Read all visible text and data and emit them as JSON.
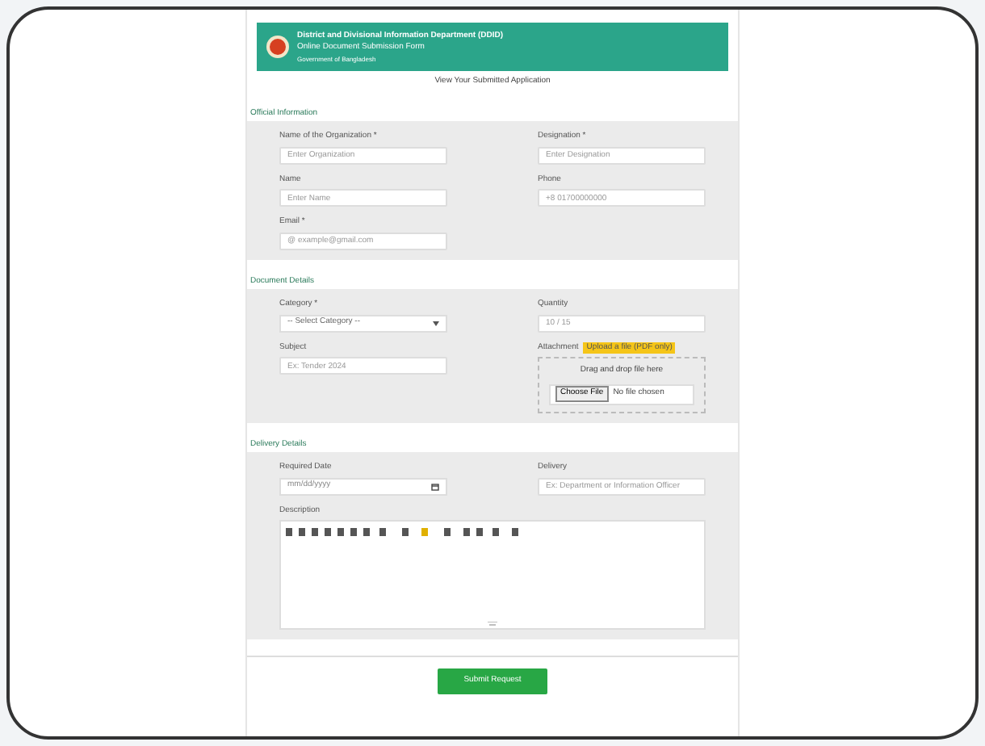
{
  "header": {
    "title": "District and Divisional Information Department (DDID)",
    "subtitle": "Online Document Submission Form",
    "tagline": "Government of Bangladesh"
  },
  "top_link": "View Your Submitted Application",
  "sections": [
    {
      "title": "Official Information",
      "fields": [
        {
          "kind": "input",
          "label": "Name of the Organization *",
          "placeholder": "Enter Organization"
        },
        {
          "kind": "input",
          "label": "Designation *",
          "placeholder": "Enter Designation"
        },
        {
          "kind": "input",
          "label": "Name",
          "placeholder": "Enter Name"
        },
        {
          "kind": "input",
          "label": "Phone",
          "placeholder": "+8 01700000000"
        },
        {
          "kind": "input",
          "label": "Email *",
          "placeholder": "@ example@gmail.com"
        }
      ]
    },
    {
      "title": "Document Details",
      "fields": [
        {
          "kind": "select",
          "label": "Category *",
          "value": "-- Select Category --"
        },
        {
          "kind": "input",
          "label": "Quantity",
          "placeholder": "10 / 15"
        },
        {
          "kind": "input",
          "label": "Subject",
          "placeholder": "Ex: Tender 2024"
        },
        {
          "kind": "upload",
          "label": "Attachment",
          "badge": "Upload a file (PDF only)",
          "drop": "Drag and drop file here",
          "button": "Choose File",
          "status": "No file chosen"
        }
      ]
    },
    {
      "title": "Delivery Details",
      "fields": [
        {
          "kind": "date",
          "label": "Required Date",
          "placeholder": "mm/dd/yyyy"
        },
        {
          "kind": "input",
          "label": "Delivery",
          "placeholder": "Ex: Department or Information Officer"
        },
        {
          "kind": "editor",
          "label": "Description"
        }
      ]
    }
  ],
  "submit": "Submit Request"
}
